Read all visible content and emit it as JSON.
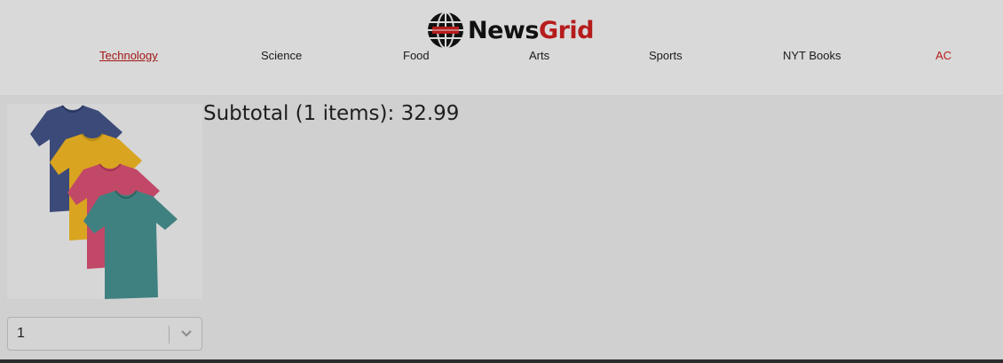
{
  "header": {
    "logo": {
      "icon": "globe-icon",
      "brand_part1": "News",
      "brand_part2": "Grid",
      "brand_color": "#b71c1c"
    },
    "nav": [
      {
        "label": "Technology",
        "active": true
      },
      {
        "label": "Science"
      },
      {
        "label": "Food"
      },
      {
        "label": "Arts"
      },
      {
        "label": "Sports"
      },
      {
        "label": "NYT Books"
      },
      {
        "label": "AC"
      }
    ]
  },
  "cart": {
    "subtotal_text": "Subtotal (1 items): 32.99",
    "item": {
      "image": "tshirts-image",
      "quantity": "1"
    }
  },
  "colors": {
    "accent": "#b71c1c",
    "header_bg": "#d9d9d9",
    "page_bg": "#d0d0d0"
  }
}
